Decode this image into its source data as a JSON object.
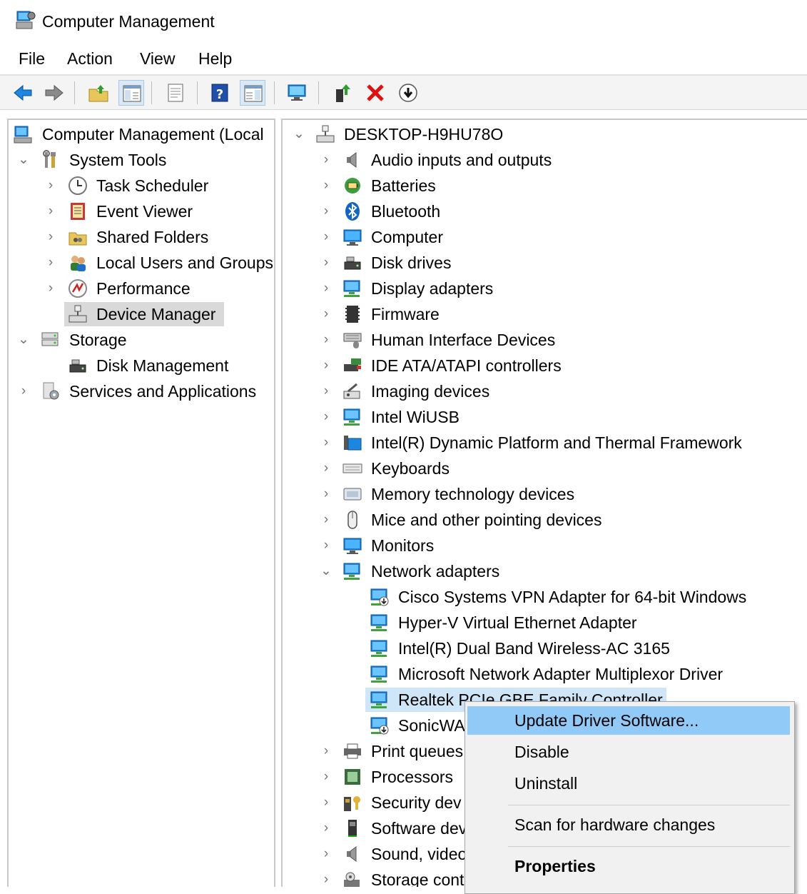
{
  "window": {
    "title": "Computer Management"
  },
  "menubar": {
    "items": [
      "File",
      "Action",
      "View",
      "Help"
    ]
  },
  "toolbar": {
    "buttons": [
      "back-arrow-icon",
      "forward-arrow-icon",
      "up-folder-icon",
      "show-hide-console-tree-icon",
      "properties-sheet-icon",
      "help-icon",
      "show-hide-action-pane-icon",
      "scan-computer-icon",
      "enable-device-icon",
      "uninstall-x-icon",
      "download-update-icon"
    ]
  },
  "left_tree": {
    "root": "Computer Management (Local",
    "system_tools": "System Tools",
    "task_scheduler": "Task Scheduler",
    "event_viewer": "Event Viewer",
    "shared_folders": "Shared Folders",
    "local_users": "Local Users and Groups",
    "performance": "Performance",
    "device_manager": "Device Manager",
    "storage": "Storage",
    "disk_management": "Disk Management",
    "services_apps": "Services and Applications"
  },
  "device_tree": {
    "computer_name": "DESKTOP-H9HU78O",
    "categories": {
      "audio": "Audio inputs and outputs",
      "batteries": "Batteries",
      "bluetooth": "Bluetooth",
      "computer": "Computer",
      "disk_drives": "Disk drives",
      "display_adapters": "Display adapters",
      "firmware": "Firmware",
      "hid": "Human Interface Devices",
      "ide": "IDE ATA/ATAPI controllers",
      "imaging": "Imaging devices",
      "intel_wiusb": "Intel WiUSB",
      "intel_dptf": "Intel(R) Dynamic Platform and Thermal Framework",
      "keyboards": "Keyboards",
      "memory_tech": "Memory technology devices",
      "mice": "Mice and other pointing devices",
      "monitors": "Monitors",
      "network_adapters": "Network adapters",
      "print_queues": "Print queues",
      "processors": "Processors",
      "security": "Security dev",
      "software": "Software dev",
      "sound": "Sound, video",
      "storage_ctrl": "Storage cont"
    },
    "network_children": {
      "cisco": "Cisco Systems VPN Adapter for 64-bit Windows",
      "hyperv": "Hyper-V Virtual Ethernet Adapter",
      "intel_wireless": "Intel(R) Dual Band Wireless-AC 3165",
      "ms_multiplexor": "Microsoft Network Adapter Multiplexor Driver",
      "realtek": "Realtek PCIe GBE Family Controller",
      "sonicwall": "SonicWA"
    }
  },
  "context_menu": {
    "update_driver": "Update Driver Software...",
    "disable": "Disable",
    "uninstall": "Uninstall",
    "scan": "Scan for hardware changes",
    "properties": "Properties"
  },
  "colors": {
    "accent_blue": "#1e86e0",
    "highlight": "#91c9f7",
    "selection_gray": "#d9d9d9",
    "red_x": "#e01010"
  }
}
